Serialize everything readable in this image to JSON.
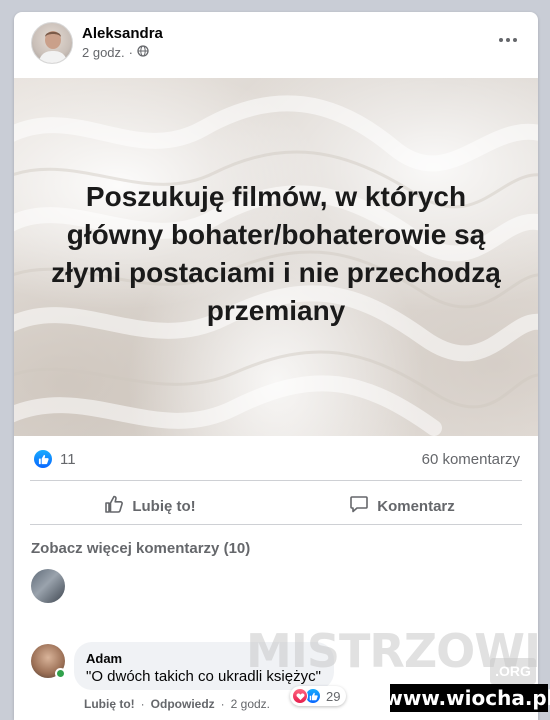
{
  "post": {
    "author": "Aleksandra",
    "time": "2 godz.",
    "separator": "·",
    "audience_icon": "globe-icon",
    "image_text": "Poszukuję filmów, w których główny bohater/bohaterowie są złymi postaciami i nie przechodzą przemiany"
  },
  "stats": {
    "reactions_count": "11",
    "comments_count": "60 komentarzy"
  },
  "actions": {
    "like_label": "Lubię to!",
    "comment_label": "Komentarz"
  },
  "comments": {
    "see_more": "Zobacz więcej komentarzy (10)",
    "items": [
      {
        "author": "Adam",
        "text": "\"O dwóch takich co ukradli księżyc\"",
        "reactions_count": "29",
        "like_action": "Lubię to!",
        "reply_action": "Odpowiedz",
        "time": "2 godz."
      }
    ]
  },
  "watermark": {
    "brand": "MISTRZOWIE",
    "brand_suffix": ".ORG",
    "site": "www.wiocha.pl"
  },
  "colors": {
    "like_blue": "#0866ff",
    "love_red": "#e61e4d",
    "online_green": "#31a24c",
    "secondary_text": "#65676b"
  }
}
